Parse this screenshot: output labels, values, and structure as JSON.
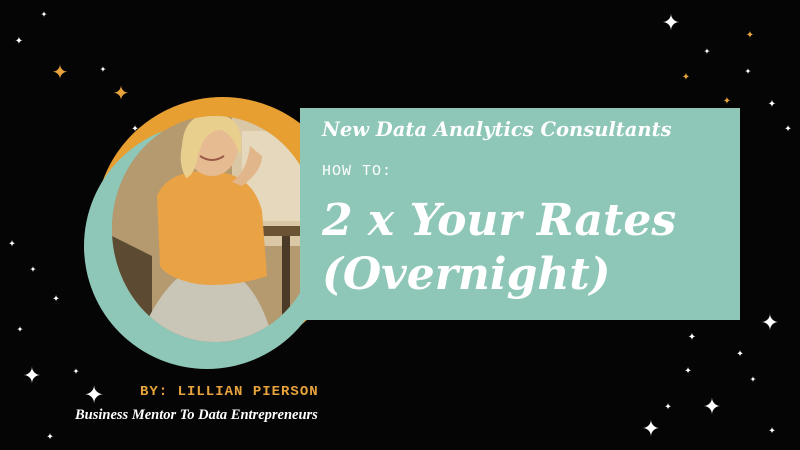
{
  "colors": {
    "background": "#050505",
    "accent_orange": "#e89f32",
    "accent_teal": "#8ec7b8",
    "text_white": "#ffffff",
    "text_gold": "#e8a33c"
  },
  "panel": {
    "title": "New Data Analytics Consultants",
    "how_to": "HOW TO:",
    "headline_line1": "2 x Your Rates",
    "headline_line2": "(Overnight)"
  },
  "byline": "BY: LILLIAN PIERSON",
  "tagline": "Business Mentor To Data Entrepreneurs",
  "photo": {
    "icon": "portrait-photo"
  },
  "decorations": {
    "icon": "sparkle-star-icon"
  }
}
